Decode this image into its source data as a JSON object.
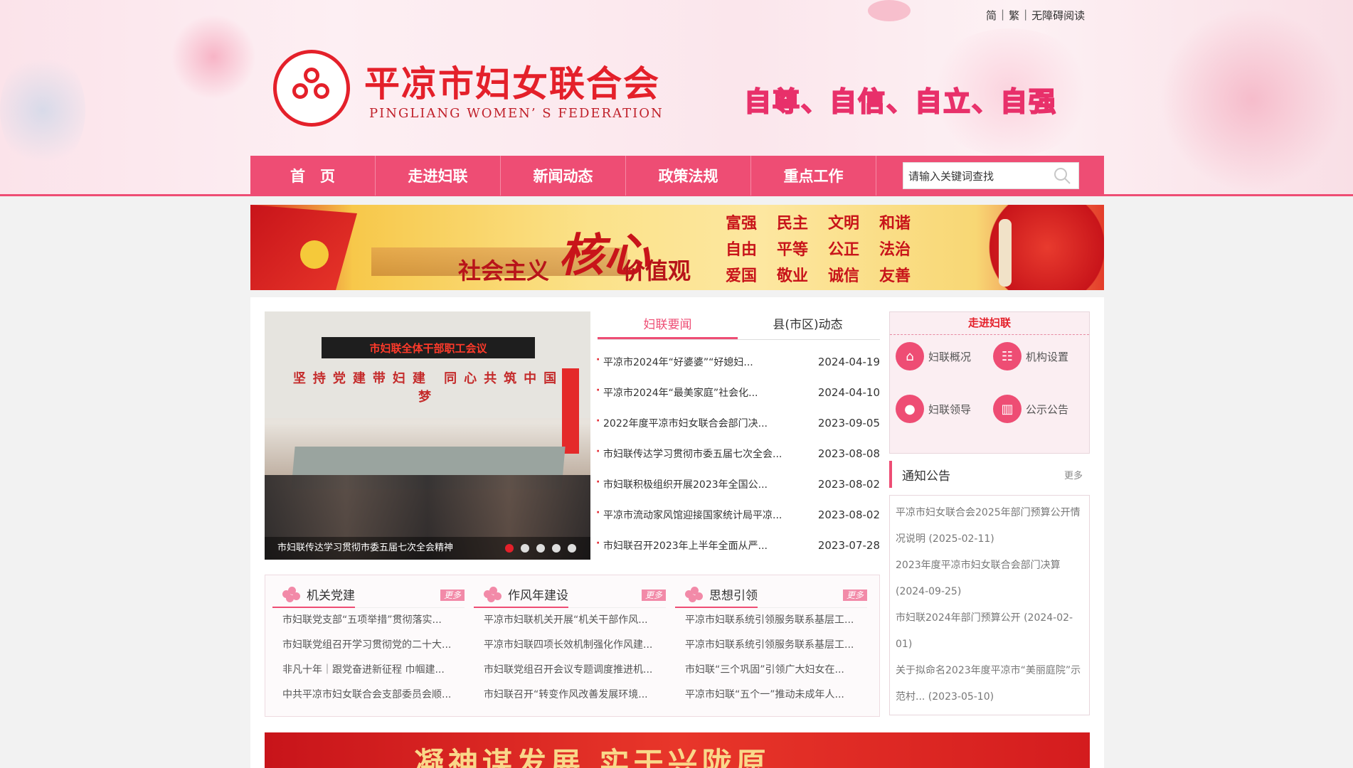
{
  "top_links": [
    "简",
    "繁",
    "无障碍阅读"
  ],
  "site": {
    "title": "平凉市妇女联合会",
    "subtitle": "PINGLIANG WOMEN’ S FEDERATION",
    "slogan": "自尊、自信、自立、自强"
  },
  "nav": {
    "items": [
      "首　页",
      "走进妇联",
      "新闻动态",
      "政策法规",
      "重点工作"
    ]
  },
  "search": {
    "placeholder": "请输入关键词查找",
    "value": "请输入关键词查找"
  },
  "banner": {
    "part1": "社会主义",
    "part2": "核心",
    "part3": "价值观",
    "values": [
      "富强",
      "民主",
      "文明",
      "和谐",
      "自由",
      "平等",
      "公正",
      "法治",
      "爱国",
      "敬业",
      "诚信",
      "友善"
    ]
  },
  "slider": {
    "sign": "市妇联全体干部职工会议",
    "wall_text": "坚持党建带妇建 同心共筑中国梦",
    "caption": "市妇联传达学习贯彻市委五届七次全会精神",
    "dots": 5,
    "active_dot": 1
  },
  "news": {
    "tabs": [
      "妇联要闻",
      "县(市区)动态"
    ],
    "items": [
      {
        "title": "平凉市2024年“好婆婆”“好媳妇...",
        "date": "2024-04-19"
      },
      {
        "title": "平凉市2024年“最美家庭”社会化...",
        "date": "2024-04-10"
      },
      {
        "title": "2022年度平凉市妇女联合会部门决...",
        "date": "2023-09-05"
      },
      {
        "title": "市妇联传达学习贯彻市委五届七次全会...",
        "date": "2023-08-08"
      },
      {
        "title": "市妇联积极组织开展2023年全国公...",
        "date": "2023-08-02"
      },
      {
        "title": "平凉市流动家风馆迎接国家统计局平凉...",
        "date": "2023-08-02"
      },
      {
        "title": "市妇联召开2023年上半年全面从严...",
        "date": "2023-07-28"
      }
    ]
  },
  "intro": {
    "title": "走进妇联",
    "items": [
      {
        "label": "妇联概况",
        "icon": "home-icon"
      },
      {
        "label": "机构设置",
        "icon": "org-chart-icon"
      },
      {
        "label": "妇联领导",
        "icon": "person-icon"
      },
      {
        "label": "公示公告",
        "icon": "bar-chart-icon"
      }
    ]
  },
  "notice": {
    "title": "通知公告",
    "more": "更多",
    "items": [
      "平凉市妇女联合会2025年部门预算公开情况说明 (2025-02-11)",
      "2023年度平凉市妇女联合会部门决算 (2024-09-25)",
      "市妇联2024年部门预算公开 (2024-02-01)",
      "关于拟命名2023年度平凉市“美丽庭院”示范村... (2023-05-10)"
    ]
  },
  "columns": [
    {
      "title": "机关党建",
      "more": "更多",
      "items": [
        "市妇联党支部“五项举措”贯彻落实...",
        "市妇联党组召开学习贯彻党的二十大...",
        "非凡十年｜跟党奋进新征程 巾帼建...",
        "中共平凉市妇女联合会支部委员会顺..."
      ]
    },
    {
      "title": "作风年建设",
      "more": "更多",
      "items": [
        "平凉市妇联机关开展“机关干部作风...",
        "平凉市妇联四项长效机制强化作风建...",
        "市妇联党组召开会议专题调度推进机...",
        "市妇联召开“转变作风改善发展环境..."
      ]
    },
    {
      "title": "思想引领",
      "more": "更多",
      "items": [
        "平凉市妇联系统引领服务联系基层工...",
        "平凉市妇联系统引领服务联系基层工...",
        "市妇联“三个巩固”引领广大妇女在...",
        "平凉市妇联“五个一”推动未成年人..."
      ]
    }
  ],
  "bottom_banner": "凝神谋发展 实干兴陇原",
  "colors": {
    "brand_red": "#e4202a",
    "nav_pink": "#ee4d74"
  }
}
